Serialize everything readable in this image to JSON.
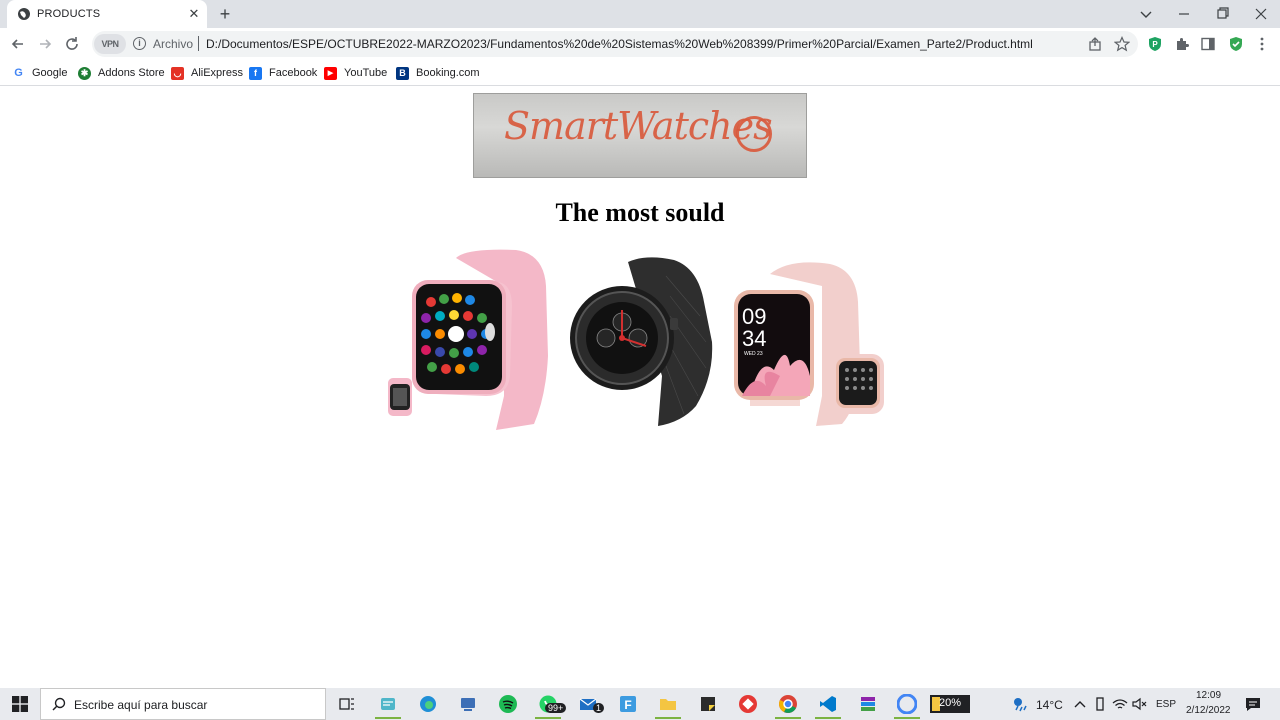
{
  "browser": {
    "tab_title": "PRODUCTS",
    "tab_close": "✕",
    "new_tab": "+",
    "vpn_label": "VPN",
    "scheme_label": "Archivo",
    "url": "D:/Documentos/ESPE/OCTUBRE2022-MARZO2023/Fundamentos%20de%20Sistemas%20Web%208399/Primer%20Parcial/Examen_Parte2/Product.html",
    "bookmarks": [
      {
        "label": "Google",
        "icon": "google-icon",
        "color": "#4285f4"
      },
      {
        "label": "Addons Store",
        "icon": "addons-store-icon",
        "color": "#1e7e34"
      },
      {
        "label": "AliExpress",
        "icon": "aliexpress-icon",
        "color": "#e43225"
      },
      {
        "label": "Facebook",
        "icon": "facebook-icon",
        "color": "#1877f2"
      },
      {
        "label": "YouTube",
        "icon": "youtube-icon",
        "color": "#ff0000"
      },
      {
        "label": "Booking.com",
        "icon": "booking-icon",
        "color": "#003580"
      }
    ]
  },
  "page": {
    "banner_text": "SmartWatches",
    "heading": "The most sould",
    "products": [
      {
        "name": "pink-square-smartwatch",
        "strap_color": "#f4b8c8",
        "screen": "apps"
      },
      {
        "name": "black-round-smartwatch",
        "strap_color": "#2b2b2b",
        "screen": "analog"
      },
      {
        "name": "rose-square-smartwatch",
        "strap_color": "#f2cfcc",
        "screen": "flower-clock"
      }
    ],
    "watch_time_hour": "09",
    "watch_time_min": "34",
    "watch_date": "WED 23"
  },
  "taskbar": {
    "search_placeholder": "Escribe aquí para buscar",
    "whatsapp_badge": "99+",
    "mail_badge": "1",
    "battery": "20%",
    "weather": "14°C",
    "language": "ESP",
    "time": "12:09",
    "date": "2/12/2022"
  },
  "colors": {
    "accent_taskbar_underline": "#7cb342",
    "banner_ink": "#d9583a"
  }
}
